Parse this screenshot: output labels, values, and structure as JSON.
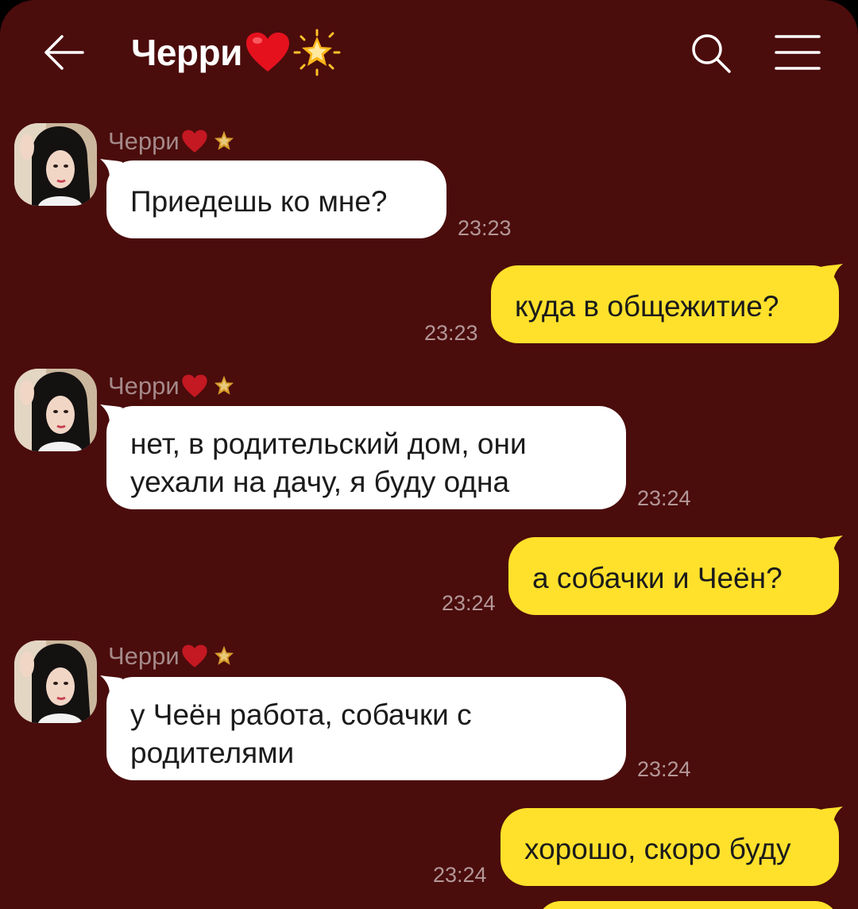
{
  "header": {
    "title": "Черри",
    "emoji": [
      "red-heart",
      "glowing-star"
    ]
  },
  "messages": [
    {
      "direction": "incoming",
      "sender": "Черри",
      "text": "Приедешь ко мне?",
      "time": "23:23"
    },
    {
      "direction": "outgoing",
      "text": "куда в общежитие?",
      "time": "23:23"
    },
    {
      "direction": "incoming",
      "sender": "Черри",
      "lines": [
        "нет, в родительский дом, они",
        "уехали на дачу, я буду одна"
      ],
      "time": "23:24"
    },
    {
      "direction": "outgoing",
      "text": "а собачки и Чеён?",
      "time": "23:24"
    },
    {
      "direction": "incoming",
      "sender": "Черри",
      "lines": [
        "у Чеён работа, собачки с",
        "родителями"
      ],
      "time": "23:24"
    },
    {
      "direction": "outgoing",
      "text": "хорошо, скоро буду",
      "time": "23:24"
    }
  ],
  "colors": {
    "background": "#4b0c0c",
    "incoming_bubble": "#ffffff",
    "outgoing_bubble": "#ffe12b",
    "time_text": "#b39797",
    "sender_text": "#a58989"
  },
  "icons": [
    "back-arrow-icon",
    "search-icon",
    "menu-icon"
  ]
}
